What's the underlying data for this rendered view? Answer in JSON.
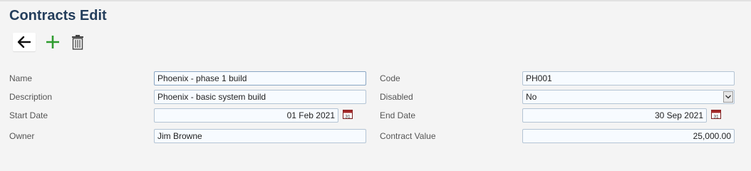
{
  "page": {
    "title": "Contracts Edit"
  },
  "toolbar": {
    "back_icon": "arrow-left-icon",
    "add_icon": "plus-icon",
    "delete_icon": "trash-icon",
    "colors": {
      "add": "#2e9b2e",
      "icon": "#333333"
    }
  },
  "form": {
    "name": {
      "label": "Name",
      "value": "Phoenix - phase 1 build"
    },
    "code": {
      "label": "Code",
      "value": "PH001"
    },
    "description": {
      "label": "Description",
      "value": "Phoenix - basic system build"
    },
    "disabled": {
      "label": "Disabled",
      "value": "No"
    },
    "start_date": {
      "label": "Start Date",
      "value": "01 Feb 2021"
    },
    "end_date": {
      "label": "End Date",
      "value": "30 Sep 2021"
    },
    "owner": {
      "label": "Owner",
      "value": "Jim Browne"
    },
    "contract_value": {
      "label": "Contract Value",
      "value": "25,000.00"
    }
  },
  "calendar_icon": {
    "day": "31"
  }
}
